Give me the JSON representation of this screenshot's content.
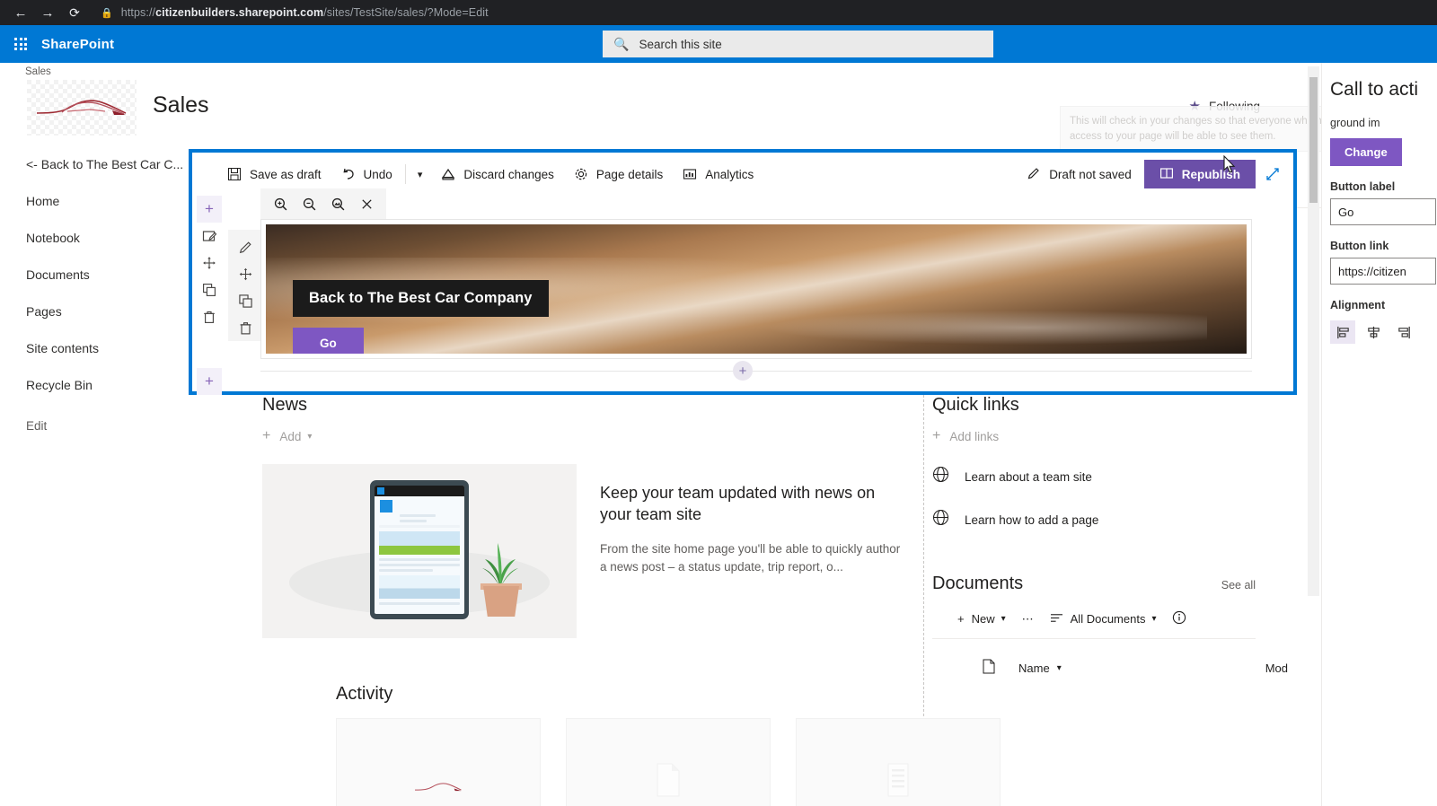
{
  "browser": {
    "back_icon": "arrow-left-icon",
    "forward_icon": "arrow-right-icon",
    "reload_icon": "reload-icon",
    "lock_icon": "lock-icon",
    "url_prefix": "https://",
    "url_domain": "citizenbuilders.sharepoint.com",
    "url_path": "/sites/TestSite/sales/?Mode=Edit"
  },
  "suite": {
    "waffle_icon": "app-launcher-icon",
    "brand": "SharePoint",
    "search_icon": "search-icon",
    "search_placeholder": "Search this site"
  },
  "site_header": {
    "breadcrumb": "Sales",
    "logo_icon": "car-logo-icon",
    "title": "Sales",
    "following_icon": "star-icon",
    "following_label": "Following",
    "checkin_tooltip": "This will check in your changes so that everyone who has access to your page will be able to see them."
  },
  "left_nav": {
    "items": [
      {
        "label": "<- Back to The Best Car C...",
        "name": "nav-back-to-best-car"
      },
      {
        "label": "Home",
        "name": "nav-home"
      },
      {
        "label": "Notebook",
        "name": "nav-notebook"
      },
      {
        "label": "Documents",
        "name": "nav-documents"
      },
      {
        "label": "Pages",
        "name": "nav-pages"
      },
      {
        "label": "Site contents",
        "name": "nav-site-contents"
      },
      {
        "label": "Recycle Bin",
        "name": "nav-recycle-bin"
      },
      {
        "label": "Edit",
        "name": "nav-edit"
      }
    ]
  },
  "command_bar": {
    "save_as_draft": "Save as draft",
    "save_icon": "save-icon",
    "undo": "Undo",
    "undo_icon": "undo-icon",
    "more_caret": "chevron-down-icon",
    "discard_changes": "Discard changes",
    "discard_icon": "discard-icon",
    "page_details": "Page details",
    "page_details_icon": "gear-icon",
    "analytics": "Analytics",
    "analytics_icon": "analytics-icon",
    "draft_status": "Draft not saved",
    "draft_status_icon": "pencil-icon",
    "republish": "Republish",
    "republish_icon": "book-icon",
    "republish_color": "#6b4fa8",
    "expand_icon": "expand-arrows-icon"
  },
  "section_rail": {
    "add_icon": "add-section-icon",
    "edit_section_icon": "edit-section-icon",
    "move_icon": "move-icon",
    "duplicate_icon": "duplicate-icon",
    "delete_icon": "trash-icon",
    "add_bottom_icon": "add-section-icon"
  },
  "webpart_rail": {
    "edit_icon": "pencil-icon",
    "move_icon": "move-icon",
    "duplicate_icon": "duplicate-icon",
    "delete_icon": "trash-icon"
  },
  "image_toolbar": {
    "zoom_in_icon": "zoom-in-icon",
    "zoom_out_icon": "zoom-out-icon",
    "fit_image_icon": "reset-image-icon",
    "close_icon": "close-icon"
  },
  "hero": {
    "title": "Back to The Best Car Company",
    "button_label": "Go",
    "button_color": "#7e57c2",
    "add_section_icon": "add-section-icon"
  },
  "news": {
    "title": "News",
    "add_label": "Add",
    "add_icon": "plus-icon",
    "add_caret": "chevron-down-icon",
    "item_heading": "Keep your team updated with news on your team site",
    "item_desc": "From the site home page you'll be able to quickly author a news post – a status update, trip report, o...",
    "thumb_icon": "tablet-illustration"
  },
  "quick_links": {
    "title": "Quick links",
    "add_label": "Add links",
    "add_icon": "plus-icon",
    "items": [
      {
        "label": "Learn about a team site",
        "icon": "globe-icon"
      },
      {
        "label": "Learn how to add a page",
        "icon": "globe-icon"
      }
    ]
  },
  "documents": {
    "title": "Documents",
    "see_all": "See all",
    "new_label": "New",
    "new_icon": "plus-icon",
    "new_caret": "chevron-down-icon",
    "overflow_icon": "ellipsis-icon",
    "view_label": "All Documents",
    "view_icon": "list-view-icon",
    "view_caret": "chevron-down-icon",
    "info_icon": "info-icon",
    "column_type_icon": "file-type-icon",
    "column_name": "Name",
    "column_name_caret": "chevron-down-icon",
    "column_modified": "Mod"
  },
  "activity": {
    "title": "Activity",
    "cards": [
      {
        "icon": "car-logo-icon"
      },
      {
        "icon": "file-icon"
      },
      {
        "icon": "list-icon"
      }
    ]
  },
  "property_pane": {
    "title": "Call to acti",
    "image_label": "ground im",
    "change_label": "Change",
    "change_color": "#7e57c2",
    "button_label_label": "Button label",
    "button_label_value": "Go",
    "button_link_label": "Button link",
    "button_link_value": "https://citizen",
    "alignment_label": "Alignment",
    "align_left_icon": "align-left-icon",
    "align_center_icon": "align-center-icon",
    "align_right_icon": "align-right-icon"
  },
  "scrollbars": {
    "up_arrow_icon": "chevron-up-icon",
    "down_arrow_icon": "chevron-down-icon"
  },
  "cursor": {
    "icon": "mouse-pointer-icon"
  }
}
